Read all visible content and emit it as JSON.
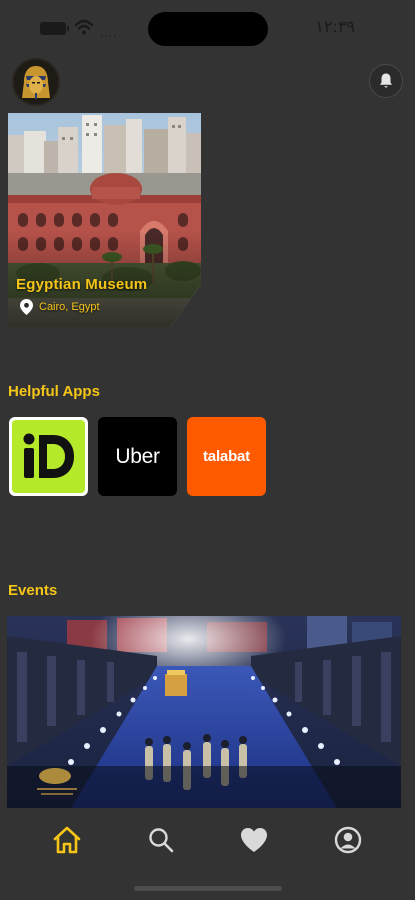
{
  "status_bar": {
    "time": "١٢:٣٩",
    "signal": "...."
  },
  "featured": {
    "title": "Egyptian Museum",
    "location": "Cairo, Egypt"
  },
  "sections": {
    "helpful_apps": "Helpful Apps",
    "events": "Events"
  },
  "apps": [
    {
      "name": "inDrive",
      "logo_text": "iD",
      "bg": "#ffffff",
      "accent": "#b5ea2a"
    },
    {
      "name": "Uber",
      "logo_text": "Uber",
      "bg": "#000000"
    },
    {
      "name": "talabat",
      "logo_text": "talabat",
      "bg": "#ff5a00"
    }
  ],
  "nav": {
    "items": [
      {
        "icon": "home-icon",
        "active": true
      },
      {
        "icon": "search-icon",
        "active": false
      },
      {
        "icon": "heart-icon",
        "active": false
      },
      {
        "icon": "profile-icon",
        "active": false
      }
    ]
  },
  "colors": {
    "background": "#333333",
    "accent": "#f5c518",
    "icon": "#d9d9d9"
  }
}
